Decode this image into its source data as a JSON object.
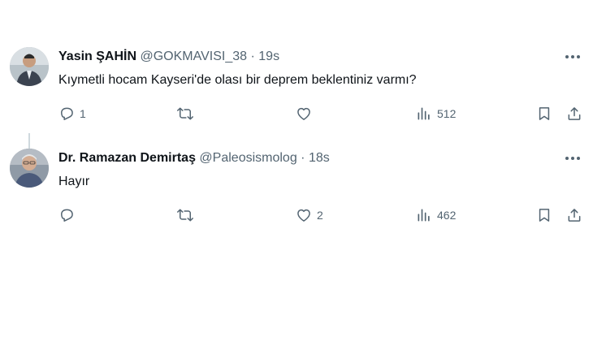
{
  "tweets": [
    {
      "name": "Yasin ŞAHİN",
      "handle": "@GOKMAVISI_38",
      "separator": "·",
      "time": "19s",
      "text": "Kıymetli hocam Kayseri'de olası bir deprem beklentiniz varmı?",
      "replies": "1",
      "retweets": "",
      "likes": "",
      "views": "512"
    },
    {
      "name": "Dr. Ramazan Demirtaş",
      "handle": "@Paleosismolog",
      "separator": "·",
      "time": "18s",
      "text": "Hayır",
      "replies": "",
      "retweets": "",
      "likes": "2",
      "views": "462"
    }
  ],
  "icons": {
    "more": "more-dots-icon",
    "reply": "reply-icon",
    "retweet": "retweet-icon",
    "like": "heart-icon",
    "views": "views-chart-icon",
    "bookmark": "bookmark-icon",
    "share": "share-icon"
  },
  "colors": {
    "text": "#0f1419",
    "secondary": "#536471",
    "thread_line": "#cfd9de"
  }
}
